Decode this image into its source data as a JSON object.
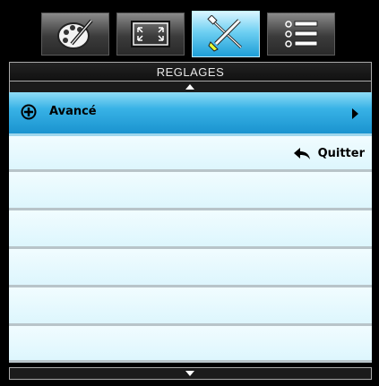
{
  "tabs": [
    {
      "icon": "palette-icon",
      "active": false
    },
    {
      "icon": "fullscreen-icon",
      "active": false
    },
    {
      "icon": "tools-icon",
      "active": true
    },
    {
      "icon": "list-icon",
      "active": false
    }
  ],
  "title": "REGLAGES",
  "menu": {
    "advanced_label": "Avancé",
    "quit_label": "Quitter"
  },
  "colors": {
    "selected_row": "#38b2e6",
    "row_background": "#e8f9fe",
    "active_tab": "#6fd0f2"
  }
}
